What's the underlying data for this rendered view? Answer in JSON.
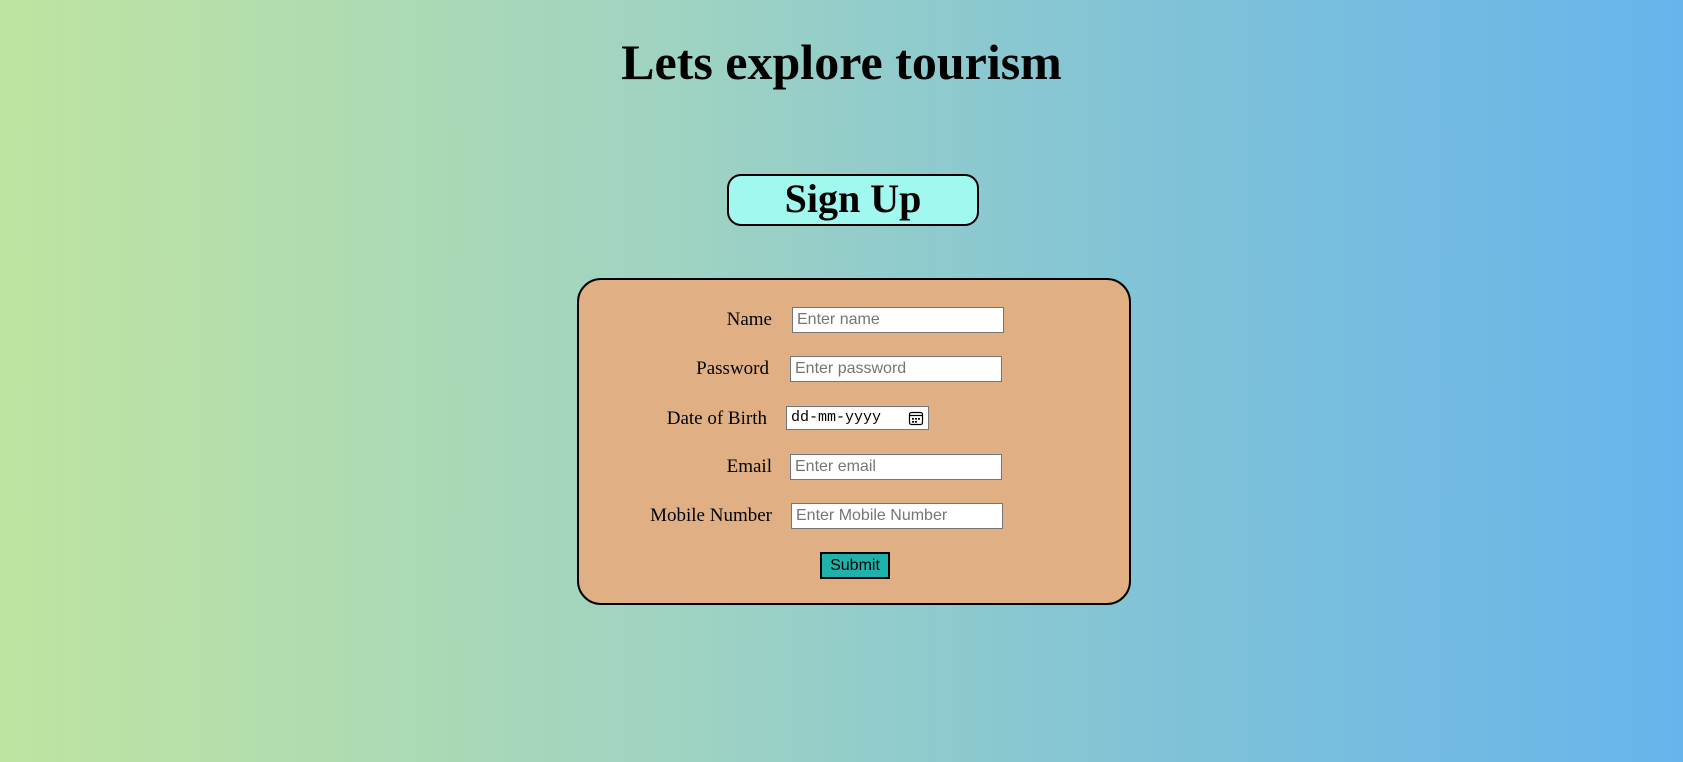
{
  "page": {
    "title": "Lets explore tourism",
    "signup_heading": "Sign Up"
  },
  "form": {
    "fields": {
      "name": {
        "label": "Name",
        "placeholder": "Enter name",
        "value": ""
      },
      "password": {
        "label": "Password",
        "placeholder": "Enter password",
        "value": ""
      },
      "dob": {
        "label": "Date of Birth",
        "display": "dd-mm-yyyy",
        "icon": "calendar-icon"
      },
      "email": {
        "label": "Email",
        "placeholder": "Enter email",
        "value": ""
      },
      "mobile": {
        "label": "Mobile Number",
        "placeholder": "Enter Mobile Number",
        "value": ""
      }
    },
    "submit_label": "Submit"
  },
  "colors": {
    "gradient_start": "#bfe4a0",
    "gradient_end": "#67b4ec",
    "signup_badge_bg": "#a0f8ee",
    "form_bg": "#e0b084",
    "submit_bg": "#20b2aa"
  }
}
